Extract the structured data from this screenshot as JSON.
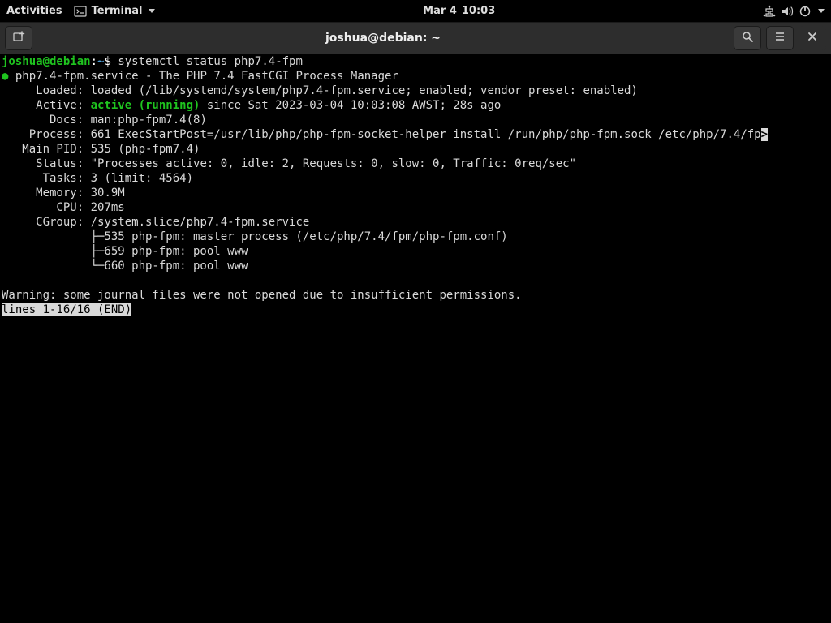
{
  "topbar": {
    "activities": "Activities",
    "app_label": "Terminal",
    "date": "Mar 4",
    "time": "10:03"
  },
  "window": {
    "title": "joshua@debian: ~"
  },
  "prompt": {
    "userhost": "joshua@debian",
    "sep": ":",
    "path": "~",
    "dollar": "$",
    "command": "systemctl status php7.4-fpm"
  },
  "svc": {
    "dot": "●",
    "unit": "php7.4-fpm.service",
    "dash": " - ",
    "desc": "The PHP 7.4 FastCGI Process Manager",
    "loaded_key": "     Loaded:",
    "loaded_val": " loaded (/lib/systemd/system/php7.4-fpm.service; enabled; vendor preset: enabled)",
    "active_key": "     Active: ",
    "active_val": "active (running)",
    "active_since": " since Sat 2023-03-04 10:03:08 AWST; 28s ago",
    "docs_key": "       Docs:",
    "docs_val": " man:php-fpm7.4(8)",
    "process_key": "    Process:",
    "process_val": " 661 ExecStartPost=/usr/lib/php/php-fpm-socket-helper install /run/php/php-fpm.sock /etc/php/7.4/fp",
    "process_trunc": ">",
    "mainpid_key": "   Main PID:",
    "mainpid_val": " 535 (php-fpm7.4)",
    "status_key": "     Status:",
    "status_val": " \"Processes active: 0, idle: 2, Requests: 0, slow: 0, Traffic: 0req/sec\"",
    "tasks_key": "      Tasks:",
    "tasks_val": " 3 (limit: 4564)",
    "memory_key": "     Memory:",
    "memory_val": " 30.9M",
    "cpu_key": "        CPU:",
    "cpu_val": " 207ms",
    "cgroup_key": "     CGroup:",
    "cgroup_val": " /system.slice/php7.4-fpm.service",
    "tree1": "             ├─535 php-fpm: master process (/etc/php/7.4/fpm/php-fpm.conf)",
    "tree2": "             ├─659 php-fpm: pool www",
    "tree3": "             └─660 php-fpm: pool www"
  },
  "warning": "Warning: some journal files were not opened due to insufficient permissions.",
  "pager": "lines 1-16/16 (END)"
}
